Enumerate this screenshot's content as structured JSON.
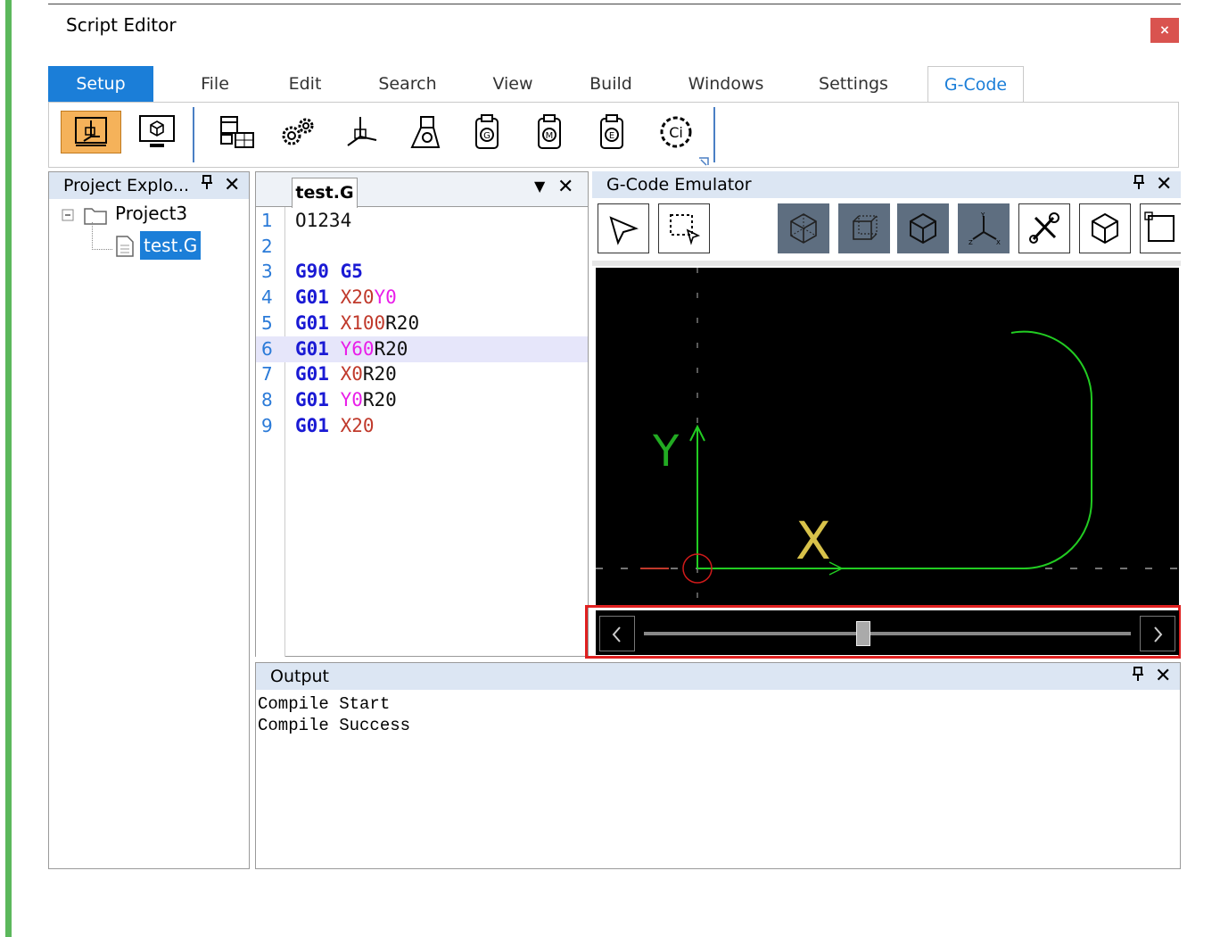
{
  "window": {
    "title": "Script Editor",
    "close": "×"
  },
  "tabs": [
    "Setup",
    "File",
    "Edit",
    "Search",
    "View",
    "Build",
    "Windows",
    "Settings",
    "G-Code"
  ],
  "ribbon": {
    "icons": [
      "gcode-setup-icon",
      "monitor-cube-icon",
      "tool-table-icon",
      "gears-icon",
      "axis-icon",
      "machine-icon",
      "g-clip-icon",
      "m-clip-icon",
      "e-clip-icon",
      "c-gear-icon"
    ]
  },
  "project_explorer": {
    "title": "Project Explo...",
    "project": "Project3",
    "file": "test.G"
  },
  "editor": {
    "tab": "test.G",
    "lines": [
      {
        "n": "1",
        "parts": [
          {
            "t": "O1234",
            "c": "blk"
          }
        ]
      },
      {
        "n": "2",
        "parts": []
      },
      {
        "n": "3",
        "parts": [
          {
            "t": "G90 G5",
            "c": "kw"
          }
        ]
      },
      {
        "n": "4",
        "parts": [
          {
            "t": "G01 ",
            "c": "kw"
          },
          {
            "t": "X20",
            "c": "red"
          },
          {
            "t": "Y0",
            "c": "mag"
          }
        ]
      },
      {
        "n": "5",
        "parts": [
          {
            "t": "G01 ",
            "c": "kw"
          },
          {
            "t": "X100",
            "c": "red"
          },
          {
            "t": "R20",
            "c": "blk"
          }
        ]
      },
      {
        "n": "6",
        "parts": [
          {
            "t": "G01 ",
            "c": "kw"
          },
          {
            "t": "Y60",
            "c": "mag"
          },
          {
            "t": "R20",
            "c": "blk"
          }
        ]
      },
      {
        "n": "7",
        "parts": [
          {
            "t": "G01 ",
            "c": "kw"
          },
          {
            "t": "X0",
            "c": "red"
          },
          {
            "t": "R20",
            "c": "blk"
          }
        ]
      },
      {
        "n": "8",
        "parts": [
          {
            "t": "G01 ",
            "c": "kw"
          },
          {
            "t": "Y0",
            "c": "mag"
          },
          {
            "t": "R20",
            "c": "blk"
          }
        ]
      },
      {
        "n": "9",
        "parts": [
          {
            "t": "G01 ",
            "c": "kw"
          },
          {
            "t": "X20",
            "c": "red"
          }
        ]
      }
    ],
    "highlighted_line": 6
  },
  "emulator": {
    "title": "G-Code Emulator",
    "axis_y": "Y",
    "axis_x": "X",
    "slider_position": 0.45
  },
  "output": {
    "title": "Output",
    "lines": [
      "Compile Start",
      "Compile Success"
    ]
  },
  "colors": {
    "accent": "#1b7ed8",
    "highlight": "#e6e6fa",
    "path": "#22cc22"
  }
}
